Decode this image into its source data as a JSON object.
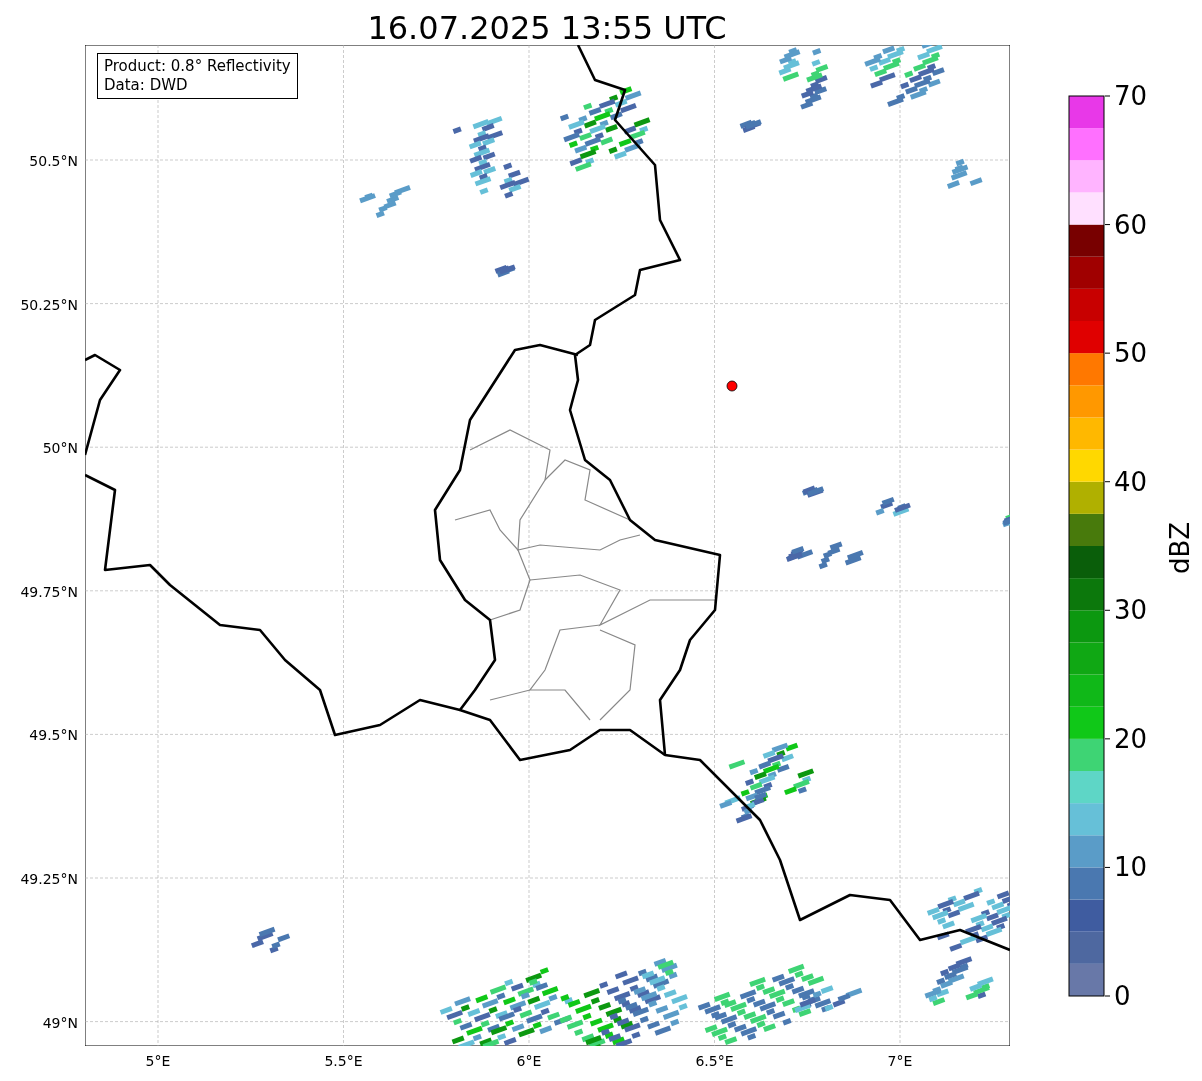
{
  "title": "16.07.2025 13:55 UTC",
  "info_box": [
    "Product: 0.8° Reflectivity",
    "Data: DWD"
  ],
  "y_ticks": [
    "50.5°N",
    "50.25°N",
    "50°N",
    "49.75°N",
    "49.5°N",
    "49.25°N",
    "49°N"
  ],
  "x_ticks": [
    "5°E",
    "5.5°E",
    "6°E",
    "6.5°E",
    "7°E"
  ],
  "colorbar": {
    "label": "dBZ",
    "ticks": [
      "70",
      "60",
      "50",
      "40",
      "30",
      "20",
      "10",
      "0"
    ]
  }
}
